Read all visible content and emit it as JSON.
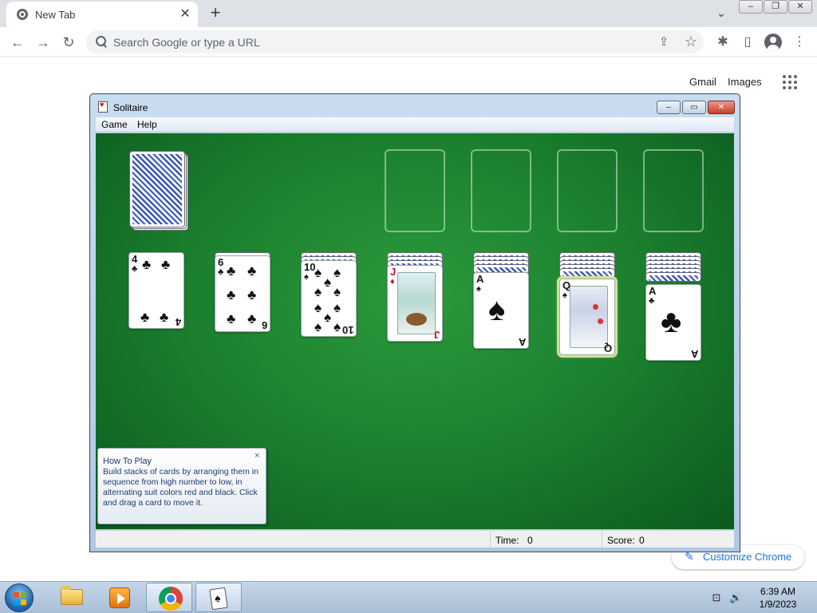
{
  "browser": {
    "tab_title": "New Tab",
    "tab_close": "✕",
    "new_tab": "+",
    "tab_search": "⌄",
    "window_controls": {
      "minimize": "–",
      "restore": "❐",
      "close": "✕"
    },
    "nav": {
      "back": "←",
      "forward": "→",
      "reload": "↻"
    },
    "omnibox_placeholder": "Search Google or type a URL",
    "omnibox_share": "⇪",
    "omnibox_star": "☆",
    "extensions_icon": "✱",
    "side_panel_icon": "▯",
    "menu_icon": "⋮"
  },
  "ntp": {
    "gmail": "Gmail",
    "images": "Images",
    "customize_icon": "✎",
    "customize_label": "Customize Chrome"
  },
  "solitaire": {
    "title": "Solitaire",
    "controls": {
      "minimize": "–",
      "maximize": "▭",
      "close": "✕"
    },
    "menu": [
      "Game",
      "Help"
    ],
    "tableau": [
      {
        "rank": "4",
        "suit": "♣",
        "color": "black"
      },
      {
        "rank": "6",
        "suit": "♣",
        "color": "black"
      },
      {
        "rank": "10",
        "suit": "♠",
        "color": "black"
      },
      {
        "rank": "J",
        "suit": "♦",
        "color": "red"
      },
      {
        "rank": "A",
        "suit": "♠",
        "color": "black"
      },
      {
        "rank": "Q",
        "suit": "♠",
        "color": "black"
      },
      {
        "rank": "A",
        "suit": "♣",
        "color": "black"
      }
    ],
    "tip": {
      "close": "×",
      "title": "How To Play",
      "body": "Build stacks of cards by arranging them in sequence from high number to low, in alternating suit colors red and black. Click and drag a card to move it."
    },
    "status": {
      "time_label": "Time:",
      "time_value": "0",
      "score_label": "Score:",
      "score_value": "0"
    }
  },
  "taskbar": {
    "tray_network": "⊡",
    "tray_volume": "🔊",
    "time": "6:39 AM",
    "date": "1/9/2023"
  }
}
